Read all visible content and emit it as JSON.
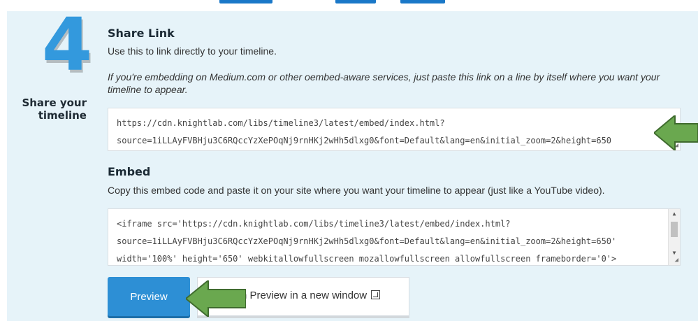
{
  "step": {
    "number": "4",
    "title_line1": "Share your",
    "title_line2": "timeline"
  },
  "share": {
    "heading": "Share Link",
    "desc": "Use this to link directly to your timeline.",
    "note": "If you're embedding on Medium.com or other oembed-aware services, just paste this link on a line by itself where you want your timeline to appear.",
    "url_line1": "https://cdn.knightlab.com/libs/timeline3/latest/embed/index.html?",
    "url_line2": "source=1iLLAyFVBHju3C6RQccYzXePOqNj9rnHKj2wHh5dlxg0&font=Default&lang=en&initial_zoom=2&height=650"
  },
  "embed": {
    "heading": "Embed",
    "desc": "Copy this embed code and paste it on your site where you want your timeline to appear (just like a YouTube video).",
    "code_line1": "<iframe src='https://cdn.knightlab.com/libs/timeline3/latest/embed/index.html?",
    "code_line2": "source=1iLLAyFVBHju3C6RQccYzXePOqNj9rnHKj2wHh5dlxg0&font=Default&lang=en&initial_zoom=2&height=650'",
    "code_line3": "width='100%' height='650' webkitallowfullscreen mozallowfullscreen allowfullscreen frameborder='0'>"
  },
  "buttons": {
    "preview": "Preview",
    "open_preview": "n Preview in a new window"
  },
  "colors": {
    "panel_bg": "#e6f3f9",
    "accent_blue": "#2d8fd5",
    "arrow_green": "#6aa84f"
  },
  "icons": {
    "external": "external-window-icon",
    "arrow": "green-pointer-arrow"
  }
}
